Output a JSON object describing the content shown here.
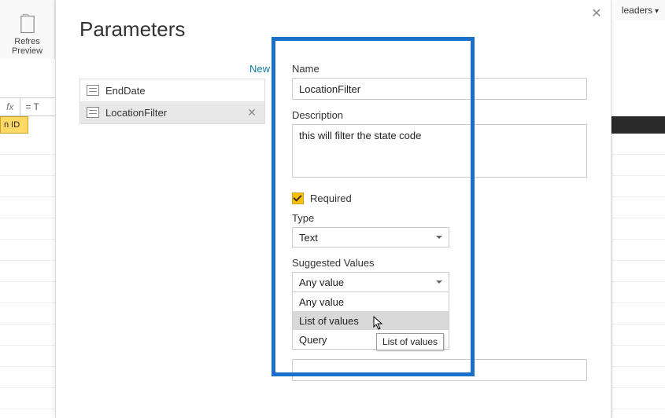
{
  "ribbon": {
    "refresh_label": "Refres\nPreview",
    "headers_label": "leaders"
  },
  "fx": {
    "label": "fx",
    "eq": "= T"
  },
  "grid": {
    "col_header": "n ID"
  },
  "dialog": {
    "title": "Parameters",
    "close": "✕",
    "new_link": "New",
    "params": [
      {
        "label": "EndDate"
      },
      {
        "label": "LocationFilter"
      }
    ]
  },
  "form": {
    "name_label": "Name",
    "name_value": "LocationFilter",
    "desc_label": "Description",
    "desc_value": "this will filter the state code",
    "required_label": "Required",
    "type_label": "Type",
    "type_value": "Text",
    "suggested_label": "Suggested Values",
    "suggested_value": "Any value",
    "options": [
      {
        "label": "Any value"
      },
      {
        "label": "List of values"
      },
      {
        "label": "Query"
      }
    ]
  },
  "tooltip": "List of values"
}
